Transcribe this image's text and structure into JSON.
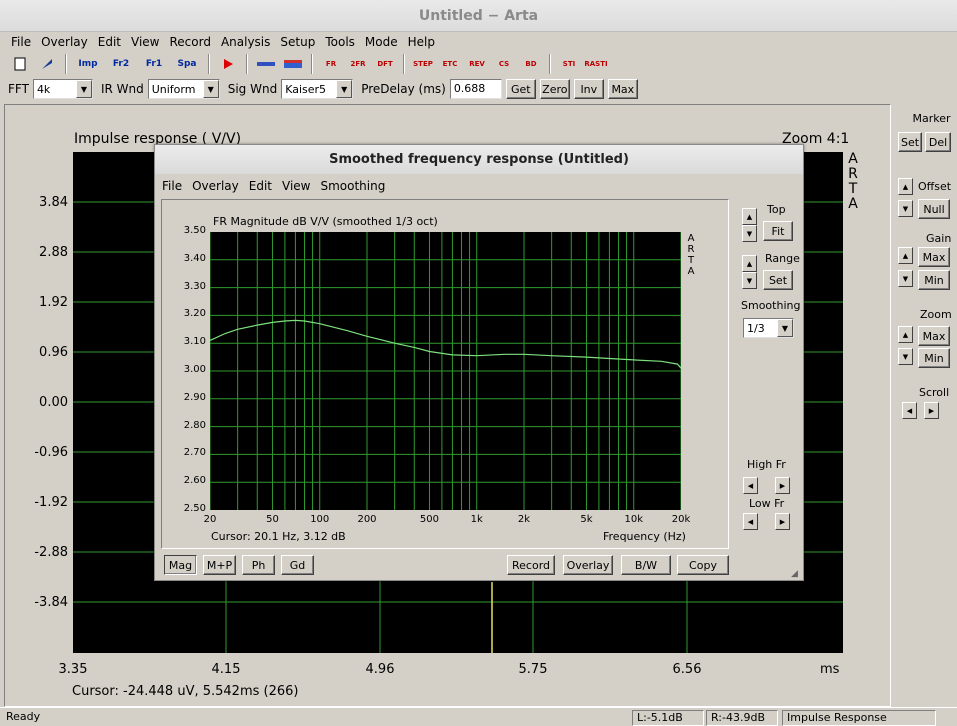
{
  "window": {
    "title": "Untitled − Arta"
  },
  "menu": [
    "File",
    "Overlay",
    "Edit",
    "View",
    "Record",
    "Analysis",
    "Setup",
    "Tools",
    "Mode",
    "Help"
  ],
  "toolbar": {
    "buttons": [
      "new-icon",
      "open-icon",
      "Imp",
      "Fr2",
      "Fr1",
      "Spa",
      "record-icon",
      "generator-icon",
      "mic-icon",
      "FR",
      "2FR",
      "DFT",
      "STEP",
      "ETC",
      "REV",
      "CS",
      "BD",
      "STI",
      "RASTI"
    ]
  },
  "toolbar2": {
    "fft_label": "FFT",
    "fft_value": "4k",
    "irwnd_label": "IR Wnd",
    "irwnd_value": "Uniform",
    "sigwnd_label": "Sig Wnd",
    "sigwnd_value": "Kaiser5",
    "predelay_label": "PreDelay (ms)",
    "predelay_value": "0.688",
    "get": "Get",
    "zero": "Zero",
    "inv": "Inv",
    "max": "Max"
  },
  "impulse": {
    "title": "Impulse response ( V/V)",
    "zoom": "Zoom 4:1",
    "arta": [
      "A",
      "R",
      "T",
      "A"
    ],
    "yticks": [
      "3.84",
      "2.88",
      "1.92",
      "0.96",
      "0.00",
      "-0.96",
      "-1.92",
      "-2.88",
      "-3.84"
    ],
    "xticks": [
      "3.35",
      "4.15",
      "4.96",
      "5.75",
      "6.56"
    ],
    "xunit": "ms",
    "cursor": "Cursor: -24.448 uV, 5.542ms (266)"
  },
  "right_panel": {
    "marker": "Marker",
    "set": "Set",
    "del": "Del",
    "offset": "Offset",
    "null": "Null",
    "gain": "Gain",
    "gain_max": "Max",
    "gain_min": "Min",
    "zoom": "Zoom",
    "zoom_max": "Max",
    "zoom_min": "Min",
    "scroll": "Scroll"
  },
  "status": {
    "ready": "Ready",
    "left": "L:-5.1dB",
    "right": "R:-43.9dB",
    "mode": "Impulse Response"
  },
  "dialog": {
    "title": "Smoothed frequency response (Untitled)",
    "menu": [
      "File",
      "Overlay",
      "Edit",
      "View",
      "Smoothing"
    ],
    "top": "Top",
    "fit": "Fit",
    "range": "Range",
    "set": "Set",
    "smoothing": "Smoothing",
    "smoothing_value": "1/3",
    "highfr": "High Fr",
    "lowfr": "Low Fr",
    "buttons_left": [
      "Mag",
      "M+P",
      "Ph",
      "Gd"
    ],
    "buttons_right": [
      "Record",
      "Overlay",
      "B/W",
      "Copy"
    ],
    "arta": [
      "A",
      "R",
      "T",
      "A"
    ]
  },
  "chart_data": {
    "type": "line",
    "title": "FR Magnitude dB V/V (smoothed 1/3 oct)",
    "xlabel": "Frequency (Hz)",
    "ylabel": "",
    "xscale": "log",
    "xlim": [
      20,
      20000
    ],
    "ylim": [
      2.5,
      3.5
    ],
    "xtick_labels": [
      "20",
      "50",
      "100",
      "200",
      "500",
      "1k",
      "2k",
      "5k",
      "10k",
      "20k"
    ],
    "ytick_labels": [
      "3.50",
      "3.40",
      "3.30",
      "3.20",
      "3.10",
      "3.00",
      "2.90",
      "2.80",
      "2.70",
      "2.60",
      "2.50"
    ],
    "cursor": "Cursor: 20.1 Hz, 3.12 dB",
    "series": [
      {
        "color": "#7fe07f",
        "x": [
          20,
          25,
          30,
          40,
          50,
          60,
          70,
          80,
          100,
          150,
          200,
          300,
          400,
          500,
          700,
          1000,
          1500,
          2000,
          3000,
          5000,
          7000,
          10000,
          15000,
          19000,
          20000
        ],
        "values": [
          3.11,
          3.135,
          3.15,
          3.165,
          3.175,
          3.18,
          3.182,
          3.18,
          3.17,
          3.145,
          3.125,
          3.1,
          3.085,
          3.07,
          3.058,
          3.055,
          3.06,
          3.06,
          3.055,
          3.05,
          3.045,
          3.04,
          3.035,
          3.025,
          3.01
        ]
      }
    ]
  }
}
